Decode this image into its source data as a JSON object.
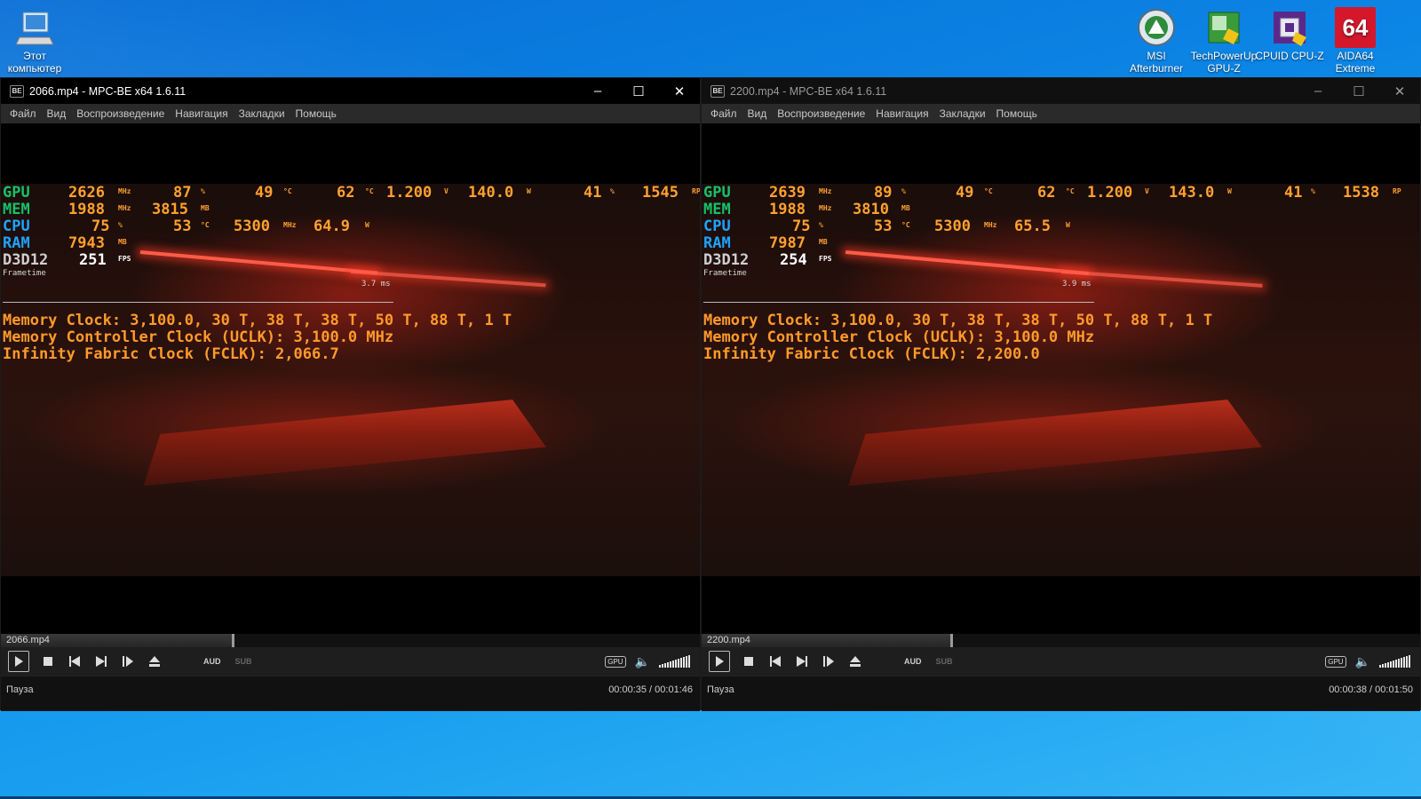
{
  "desktop": {
    "icons": [
      {
        "label_1": "Этот",
        "label_2": "компьютер"
      },
      {
        "label_1": "MSI",
        "label_2": "Afterburner"
      },
      {
        "label_1": "TechPowerUp",
        "label_2": "GPU-Z"
      },
      {
        "label_1": "CPUID CPU-Z",
        "label_2": ""
      },
      {
        "label_1": "AIDA64",
        "label_2": "Extreme",
        "badge": "64"
      }
    ]
  },
  "menu": [
    "Файл",
    "Вид",
    "Воспроизведение",
    "Навигация",
    "Закладки",
    "Помощь"
  ],
  "window_controls": {
    "minimize": "–",
    "maximize": "☐",
    "close": "✕"
  },
  "osd_labels": {
    "gpu": "GPU",
    "mem": "MEM",
    "cpu": "CPU",
    "ram": "RAM",
    "api": "D3D12",
    "frametime": "Frametime"
  },
  "units": {
    "mhz": "MHz",
    "pct": "%",
    "deg": "°C",
    "volt": "V",
    "watt": "W",
    "mb": "MB",
    "fps": "FPS",
    "rpm": "RP"
  },
  "controls": {
    "aud": "AUD",
    "sub": "SUB",
    "gpu": "GPU"
  },
  "windows": [
    {
      "title": "2066.mp4 - MPC-BE x64 1.6.11",
      "active": true,
      "file": "2066.mp4",
      "status": "Пауза",
      "time": "00:00:35 / 00:01:46",
      "progress": 0.33,
      "osd": {
        "gpu": [
          "2626",
          "87",
          "49",
          "62",
          "1.200",
          "140.0",
          "41",
          "1545"
        ],
        "mem": [
          "1988",
          "3815"
        ],
        "cpu": [
          "75",
          "53",
          "5300",
          "64.9"
        ],
        "ram": "7943",
        "fps": "251",
        "frametime_ms": "3.7 ms"
      },
      "overlay_lines": [
        "Memory Clock: 3,100.0, 30 T, 38 T, 38 T, 50 T, 88 T, 1 T",
        "Memory Controller Clock (UCLK): 3,100.0 MHz",
        "Infinity Fabric Clock (FCLK): 2,066.7"
      ]
    },
    {
      "title": "2200.mp4 - MPC-BE x64 1.6.11",
      "active": false,
      "file": "2200.mp4",
      "status": "Пауза",
      "time": "00:00:38 / 00:01:50",
      "progress": 0.345,
      "osd": {
        "gpu": [
          "2639",
          "89",
          "49",
          "62",
          "1.200",
          "143.0",
          "41",
          "1538"
        ],
        "mem": [
          "1988",
          "3810"
        ],
        "cpu": [
          "75",
          "53",
          "5300",
          "65.5"
        ],
        "ram": "7987",
        "fps": "254",
        "frametime_ms": "3.9 ms"
      },
      "overlay_lines": [
        "Memory Clock: 3,100.0, 30 T, 38 T, 38 T, 50 T, 88 T, 1 T",
        "Memory Controller Clock (UCLK): 3,100.0 MHz",
        "Infinity Fabric Clock (FCLK): 2,200.0"
      ]
    }
  ]
}
